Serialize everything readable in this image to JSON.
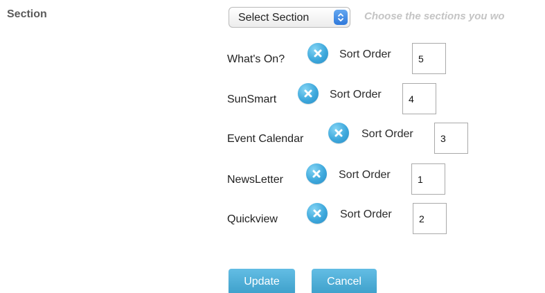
{
  "section": {
    "label": "Section",
    "select_value": "Select Section",
    "helper_text": "Choose the sections you wo"
  },
  "rows": [
    {
      "label": "What's On?",
      "sort_label": "Sort Order",
      "sort_value": "5"
    },
    {
      "label": "SunSmart",
      "sort_label": "Sort Order",
      "sort_value": "4"
    },
    {
      "label": "Event Calendar",
      "sort_label": "Sort Order",
      "sort_value": "3"
    },
    {
      "label": "NewsLetter",
      "sort_label": "Sort Order",
      "sort_value": "1"
    },
    {
      "label": "Quickview",
      "sort_label": "Sort Order",
      "sort_value": "2"
    }
  ],
  "buttons": {
    "update": "Update",
    "cancel": "Cancel"
  },
  "icons": {
    "remove": "close-icon",
    "select_arrows": "chevron-up-down-icon"
  },
  "colors": {
    "accent": "#3ea8dc",
    "button": "#4aaed7",
    "helper_text": "#c4c4c4"
  }
}
